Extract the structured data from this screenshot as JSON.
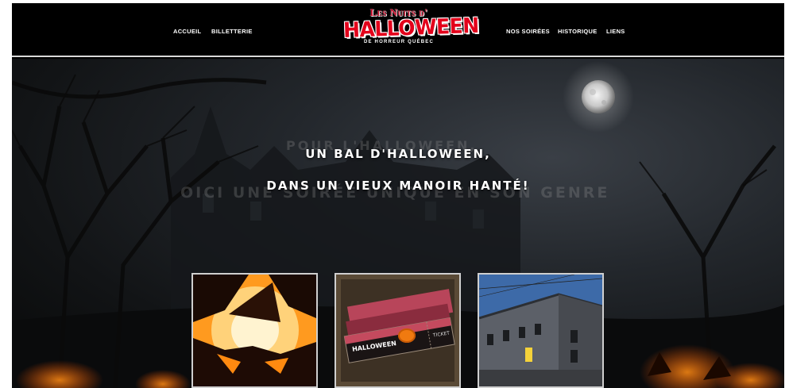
{
  "nav": {
    "left": [
      "ACCUEIL",
      "BILLETTERIE"
    ],
    "right": [
      "NOS SOIRÉES",
      "HISTORIQUE",
      "LIENS"
    ]
  },
  "logo": {
    "top": "Les Nuits d'",
    "main": "HALLOWEEN",
    "sub": "DE HORREUR QUÉBEC"
  },
  "hero": {
    "ghost_line_1": "POUR L'HALLOWEEN,",
    "ghost_line_2": "OICI UNE SOIRÉE UNIQUE EN SON GENRE",
    "headline_1": "UN BAL D'HALLOWEEN,",
    "headline_2": "DANS UN VIEUX MANOIR HANTÉ!"
  },
  "cards": [
    {
      "image": "jack-o-lantern"
    },
    {
      "image": "tickets",
      "ticket_logo": "HALLOWEEN",
      "ticket_label": "TICKET"
    },
    {
      "image": "stone-manor"
    }
  ],
  "colors": {
    "accent": "#e3001b",
    "header": "#000000"
  }
}
